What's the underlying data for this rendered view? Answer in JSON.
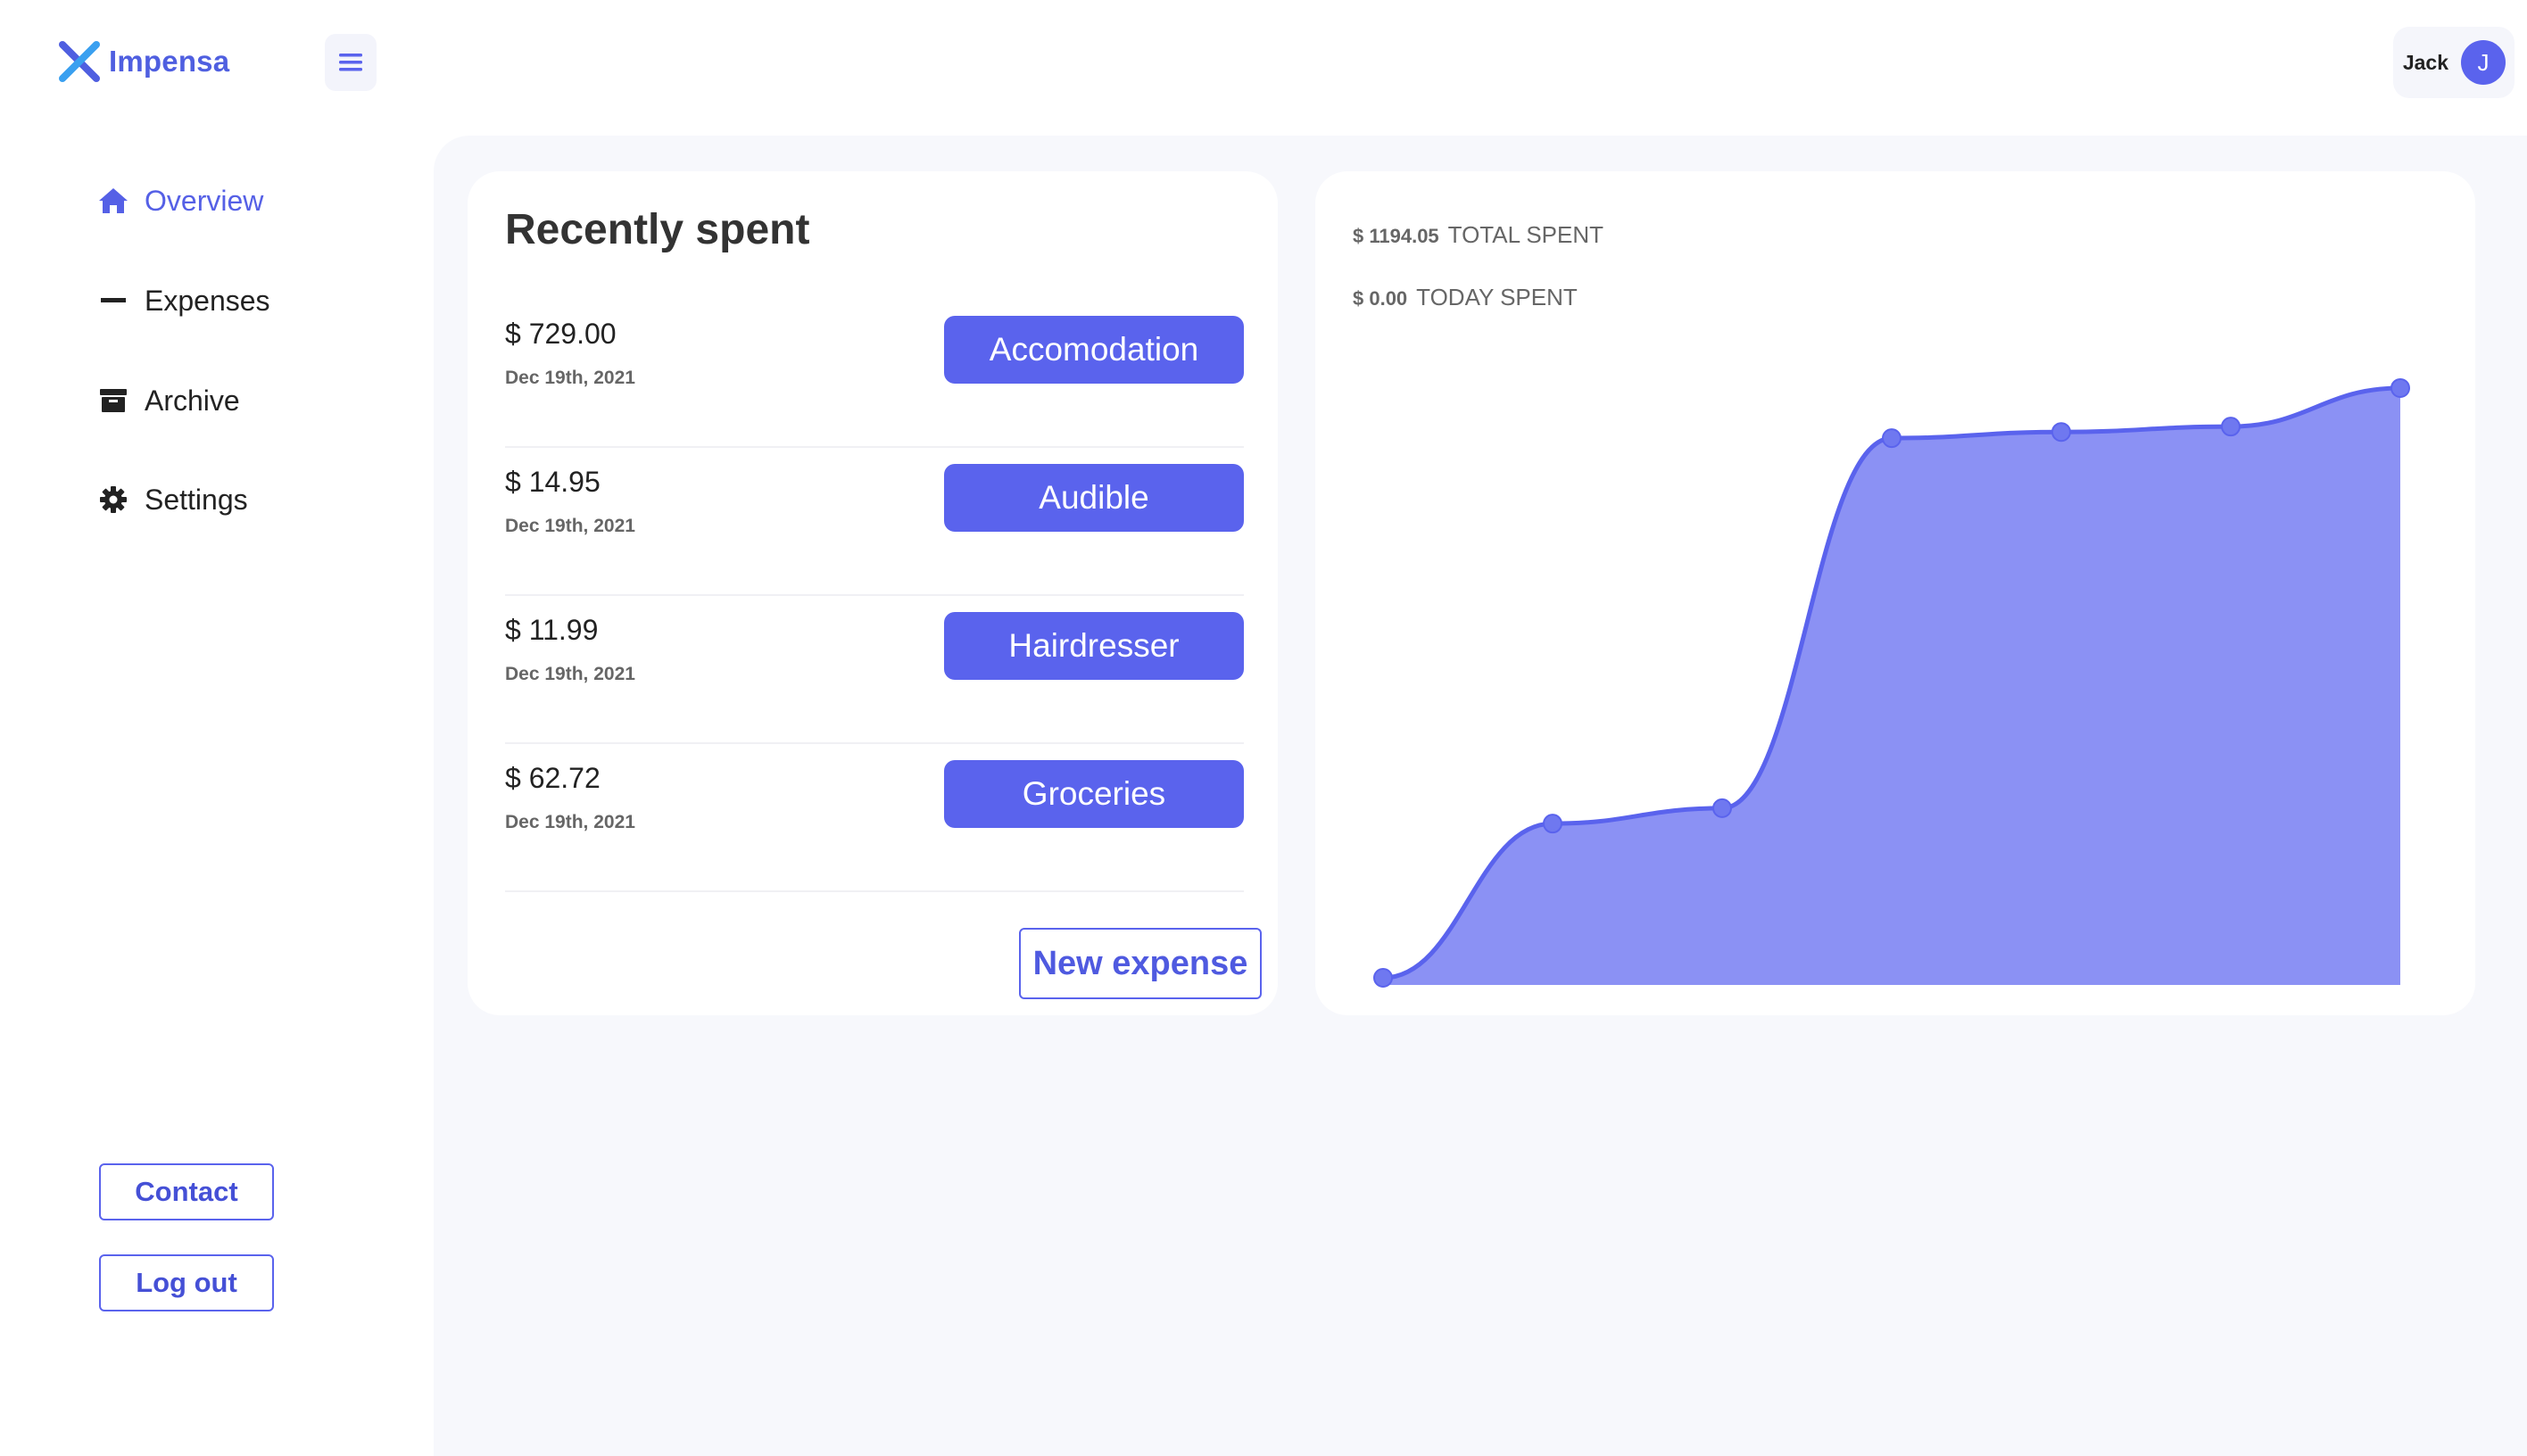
{
  "app": {
    "name": "Impensa"
  },
  "header": {
    "user_name": "Jack",
    "avatar_initial": "J"
  },
  "sidebar": {
    "items": [
      {
        "label": "Overview",
        "icon": "home-icon",
        "active": true
      },
      {
        "label": "Expenses",
        "icon": "minus-icon",
        "active": false
      },
      {
        "label": "Archive",
        "icon": "archive-icon",
        "active": false
      },
      {
        "label": "Settings",
        "icon": "gear-icon",
        "active": false
      }
    ],
    "contact_label": "Contact",
    "logout_label": "Log out"
  },
  "recent": {
    "title": "Recently spent",
    "expenses": [
      {
        "amount": "$ 729.00",
        "date": "Dec 19th, 2021",
        "category": "Accomodation"
      },
      {
        "amount": "$ 14.95",
        "date": "Dec 19th, 2021",
        "category": "Audible"
      },
      {
        "amount": "$ 11.99",
        "date": "Dec 19th, 2021",
        "category": "Hairdresser"
      },
      {
        "amount": "$ 62.72",
        "date": "Dec 19th, 2021",
        "category": "Groceries"
      }
    ],
    "new_expense_label": "New expense"
  },
  "stats": {
    "total_value": "$ 1194.05",
    "total_label": "TOTAL SPENT",
    "today_value": "$ 0.00",
    "today_label": "TODAY SPENT"
  },
  "colors": {
    "accent": "#5a63ed",
    "fill": "#8b91f4"
  },
  "chart_data": {
    "type": "area",
    "x": [
      1,
      2,
      3,
      4,
      5,
      6,
      7
    ],
    "values": [
      0,
      200,
      220,
      700,
      708,
      715,
      765
    ],
    "title": "",
    "xlabel": "",
    "ylabel": "",
    "grid": false,
    "ylim": [
      0,
      780
    ]
  }
}
